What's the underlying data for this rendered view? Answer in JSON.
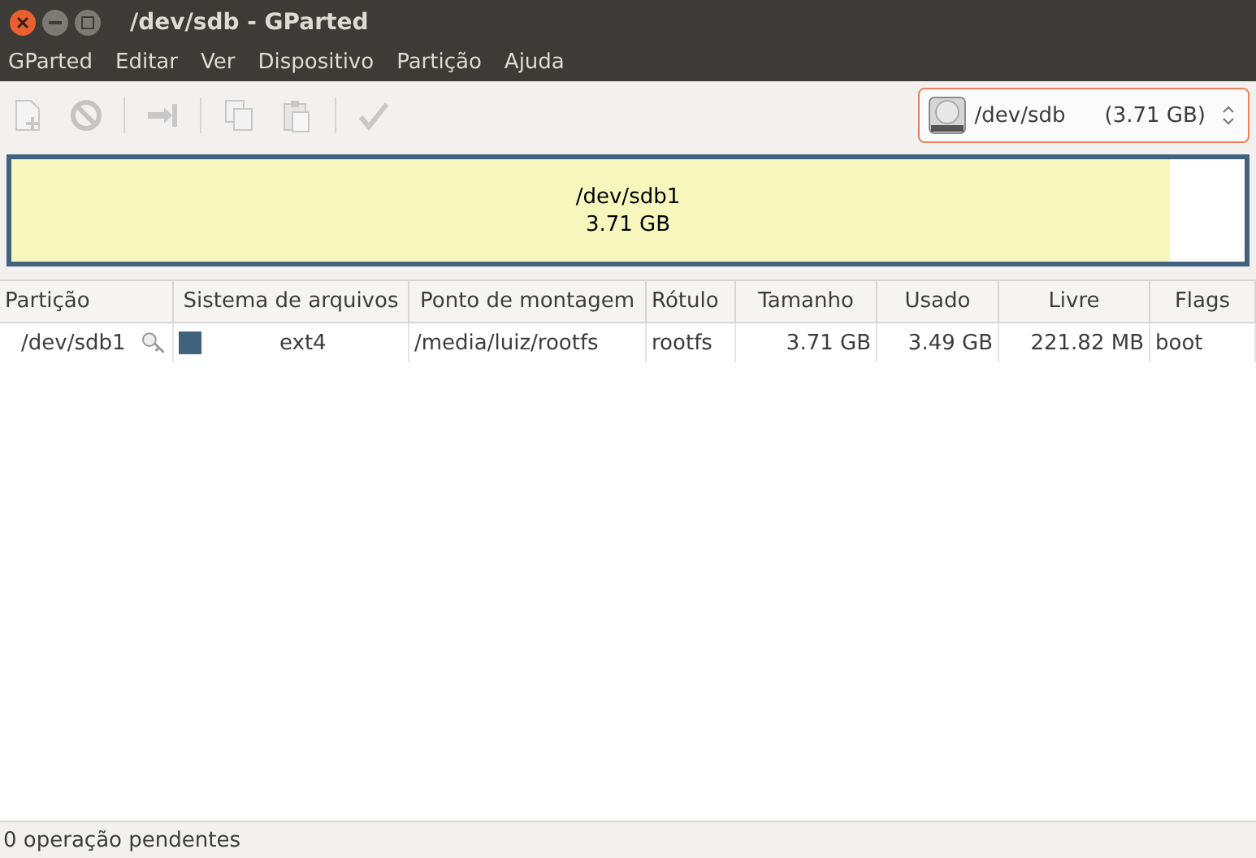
{
  "window": {
    "title": "/dev/sdb - GParted"
  },
  "menu": [
    "GParted",
    "Editar",
    "Ver",
    "Dispositivo",
    "Partição",
    "Ajuda"
  ],
  "toolbar": [
    {
      "kind": "new",
      "disabled": true
    },
    {
      "kind": "delete",
      "disabled": true
    },
    {
      "kind": "separator"
    },
    {
      "kind": "resize",
      "disabled": true
    },
    {
      "kind": "separator"
    },
    {
      "kind": "copy",
      "disabled": true
    },
    {
      "kind": "paste",
      "disabled": true
    },
    {
      "kind": "separator"
    },
    {
      "kind": "apply",
      "disabled": true
    }
  ],
  "device": {
    "name": "/dev/sdb",
    "size": "(3.71 GB)"
  },
  "partition_map": [
    {
      "name": "/dev/sdb1",
      "size": "3.71 GB",
      "level": 0.94,
      "color": "#42617d"
    }
  ],
  "table": {
    "columns": [
      "Partição",
      "Sistema de arquivos",
      "Ponto de montagem",
      "Rótulo",
      "Tamanho",
      "Usado",
      "Livre",
      "Flags"
    ],
    "rows": [
      {
        "partition": "/dev/sdb1",
        "mounted": true,
        "color": "#42617d",
        "filesystem": "ext4",
        "mount_point": "/media/luiz/rootfs",
        "label": "rootfs",
        "size": "3.71 GB",
        "used": "3.49 GB",
        "free": "221.82 MB",
        "flags": "boot",
        "selected": false
      }
    ]
  },
  "status_bar": "0 operação pendentes"
}
